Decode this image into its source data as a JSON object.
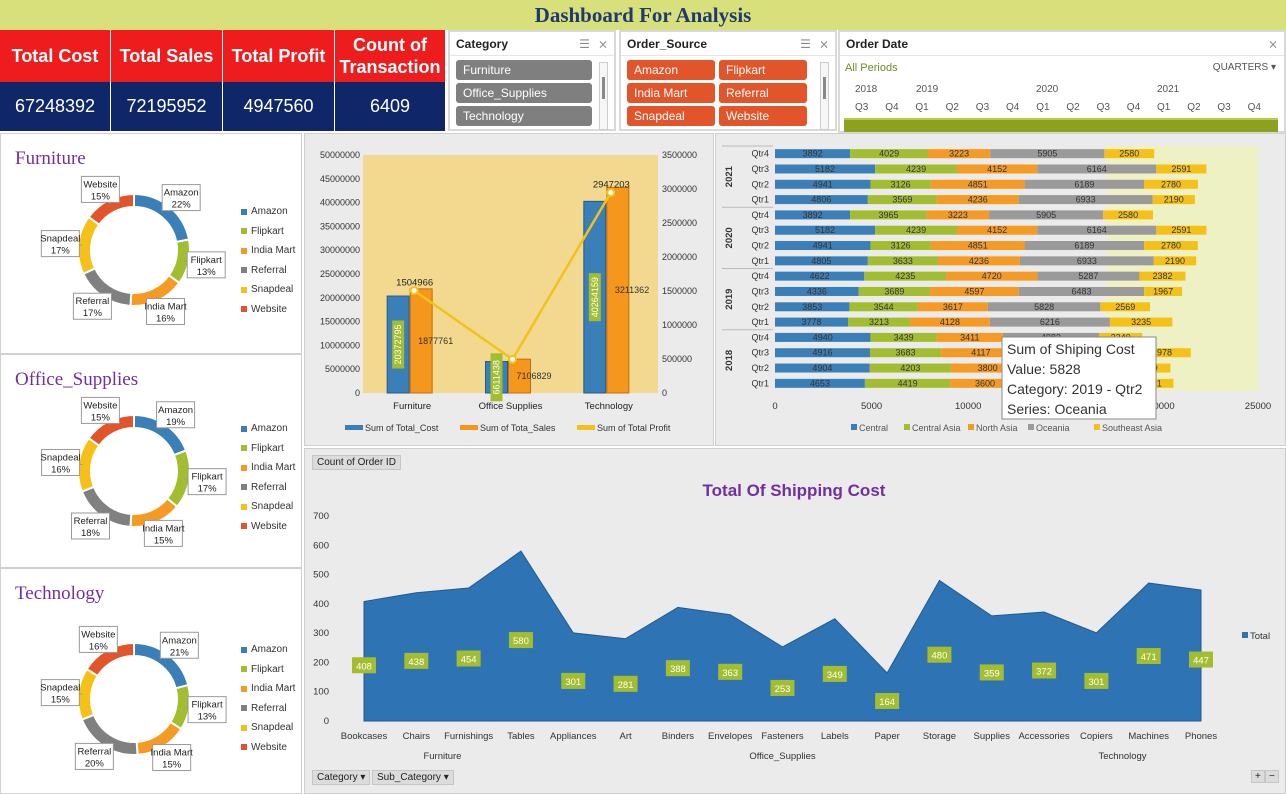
{
  "title": "Dashboard For Analysis",
  "kpis": [
    {
      "label": "Total Cost",
      "value": "67248392"
    },
    {
      "label": "Total Sales",
      "value": "72195952"
    },
    {
      "label": "Total Profit",
      "value": "4947560"
    },
    {
      "label": "Count of Transaction",
      "value": "6409"
    }
  ],
  "category_slicer": {
    "title": "Category",
    "items": [
      "Furniture",
      "Office_Supplies",
      "Technology"
    ]
  },
  "order_source_slicer": {
    "title": "Order_Source",
    "items": [
      "Amazon",
      "Flipkart",
      "India Mart",
      "Referral",
      "Snapdeal",
      "Website"
    ]
  },
  "timeline": {
    "title": "Order Date",
    "periods_label": "All Periods",
    "level": "QUARTERS",
    "years": [
      "2018",
      "2019",
      "2020",
      "2021"
    ],
    "quarters": [
      "Q3",
      "Q4",
      "Q1",
      "Q2",
      "Q3",
      "Q4",
      "Q1",
      "Q2",
      "Q3",
      "Q4",
      "Q1",
      "Q2",
      "Q3",
      "Q4"
    ]
  },
  "colors": {
    "amazon": "#3a7fb8",
    "flipkart": "#a3bd31",
    "india_mart": "#f59a23",
    "referral": "#808080",
    "snapdeal": "#f5c118",
    "website": "#e2542a",
    "kpi_header": "#ee1c1c",
    "kpi_value": "#0f2768",
    "title_bar": "#d7e07a",
    "area": "#2e74b5",
    "data_label": "#a3bd31"
  },
  "pie_legend": [
    "Amazon",
    "Flipkart",
    "India Mart",
    "Referral",
    "Snapdeal",
    "Website"
  ],
  "pies": [
    {
      "title": "Furniture",
      "slices": [
        {
          "name": "Amazon",
          "pct": "22%"
        },
        {
          "name": "Flipkart",
          "pct": "13%"
        },
        {
          "name": "India Mart",
          "pct": "16%"
        },
        {
          "name": "Referral",
          "pct": "17%"
        },
        {
          "name": "Snapdeal",
          "pct": "17%"
        },
        {
          "name": "Website",
          "pct": "15%"
        }
      ]
    },
    {
      "title": "Office_Supplies",
      "slices": [
        {
          "name": "Amazon",
          "pct": "19%"
        },
        {
          "name": "Flipkart",
          "pct": "17%"
        },
        {
          "name": "India Mart",
          "pct": "15%"
        },
        {
          "name": "Referral",
          "pct": "18%"
        },
        {
          "name": "Snapdeal",
          "pct": "16%"
        },
        {
          "name": "Website",
          "pct": "15%"
        }
      ]
    },
    {
      "title": "Technology",
      "slices": [
        {
          "name": "Amazon",
          "pct": "21%"
        },
        {
          "name": "Flipkart",
          "pct": "13%"
        },
        {
          "name": "India Mart",
          "pct": "15%"
        },
        {
          "name": "Referral",
          "pct": "20%"
        },
        {
          "name": "Snapdeal",
          "pct": "15%"
        },
        {
          "name": "Website",
          "pct": "16%"
        }
      ]
    }
  ],
  "chart_data": [
    {
      "type": "bar",
      "categories": [
        "Furniture",
        "Office Supplies",
        "Technology"
      ],
      "series": [
        {
          "name": "Sum of Total_Cost",
          "values": [
            20372795,
            6611438,
            40264159
          ]
        },
        {
          "name": "Sum of Tota_Sales",
          "values": [
            21877761,
            7106829,
            43211362
          ]
        },
        {
          "name": "Sum of Total Profit",
          "values": [
            1504966,
            495391,
            2947203
          ],
          "axis": "secondary",
          "kind": "line"
        }
      ],
      "data_labels": {
        "cost": [
          "20372795",
          "6611438",
          "40264159"
        ],
        "sales": [
          "1877761",
          "7106829",
          "3211362"
        ],
        "profit": [
          "1504966",
          "",
          "2947203"
        ]
      },
      "ylim": [
        0,
        50000000
      ],
      "y2lim": [
        0,
        3500000
      ],
      "yticks": [
        "0",
        "5000000",
        "10000000",
        "15000000",
        "20000000",
        "25000000",
        "30000000",
        "35000000",
        "40000000",
        "45000000",
        "50000000"
      ],
      "y2ticks": [
        "0",
        "500000",
        "1000000",
        "1500000",
        "2000000",
        "2500000",
        "3000000",
        "3500000"
      ]
    },
    {
      "type": "bar",
      "orientation": "horizontal-stacked",
      "categories": [
        "Qtr1",
        "Qtr2",
        "Qtr3",
        "Qtr4",
        "Qtr1",
        "Qtr2",
        "Qtr3",
        "Qtr4",
        "Qtr1",
        "Qtr2",
        "Qtr3",
        "Qtr4",
        "Qtr1",
        "Qtr2",
        "Qtr3",
        "Qtr4"
      ],
      "groups": [
        {
          "year": "2018",
          "count": 4
        },
        {
          "year": "2019",
          "count": 4
        },
        {
          "year": "2020",
          "count": 4
        },
        {
          "year": "2021",
          "count": 4
        }
      ],
      "series": [
        {
          "name": "Central",
          "values": [
            4653,
            4904,
            4916,
            4940,
            3778,
            3853,
            4336,
            4622,
            4805,
            4941,
            5182,
            3892,
            4806,
            4941,
            5182,
            3892
          ]
        },
        {
          "name": "Central Asia",
          "values": [
            4419,
            4203,
            3683,
            3439,
            3213,
            3544,
            3689,
            4235,
            3633,
            3126,
            4239,
            3965,
            3569,
            3126,
            4239,
            4029
          ]
        },
        {
          "name": "North Asia",
          "values": [
            3600,
            3800,
            4117,
            3411,
            4128,
            3617,
            4597,
            4720,
            4236,
            4851,
            4152,
            3223,
            4236,
            4851,
            4152,
            3223
          ]
        },
        {
          "name": "Oceania",
          "values": [
            5700,
            5200,
            5828,
            4982,
            6216,
            5828,
            6483,
            5287,
            6933,
            6189,
            6164,
            5905,
            6933,
            6189,
            6164,
            5905
          ]
        },
        {
          "name": "Southeast Asia",
          "values": [
            2251,
            2360,
            2978,
            2240,
            3235,
            2569,
            1967,
            2382,
            2190,
            2780,
            2591,
            2580,
            2190,
            2780,
            2591,
            2580
          ]
        }
      ],
      "xlim": [
        0,
        25000
      ],
      "xticks": [
        "0",
        "5000",
        "10000",
        "15000",
        "20000",
        "25000"
      ],
      "tooltip": {
        "line1": "Sum of Shiping Cost",
        "line2": "Value: 5828",
        "line3": "Category: 2019 - Qtr2",
        "line4": "Series: Oceania"
      }
    },
    {
      "type": "area",
      "title": "Total Of Shipping Cost",
      "field_button": "Count of Order ID",
      "series_name": "Total",
      "categories": [
        "Bookcases",
        "Chairs",
        "Furnishings",
        "Tables",
        "Appliances",
        "Art",
        "Binders",
        "Envelopes",
        "Fasteners",
        "Labels",
        "Paper",
        "Storage",
        "Supplies",
        "Accessories",
        "Copiers",
        "Machines",
        "Phones"
      ],
      "values": [
        408,
        438,
        454,
        580,
        301,
        281,
        388,
        363,
        253,
        349,
        164,
        480,
        359,
        372,
        301,
        471,
        447
      ],
      "groups": [
        {
          "name": "Furniture",
          "from": 0,
          "to": 3
        },
        {
          "name": "Office_Supplies",
          "from": 4,
          "to": 12
        },
        {
          "name": "Technology",
          "from": 13,
          "to": 16
        }
      ],
      "ylim": [
        0,
        700
      ],
      "yticks": [
        "0",
        "100",
        "200",
        "300",
        "400",
        "500",
        "600",
        "700"
      ],
      "filters": [
        "Category",
        "Sub_Category"
      ],
      "zoom": [
        "+",
        "−"
      ]
    }
  ]
}
